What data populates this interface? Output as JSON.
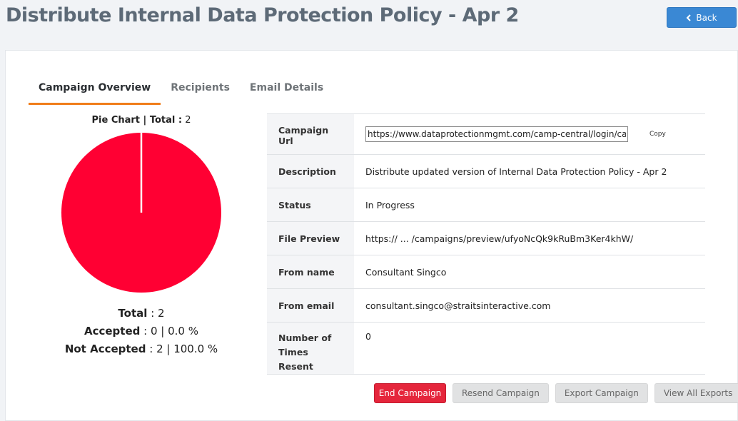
{
  "header": {
    "title": "Distribute Internal Data Protection Policy - Apr 2",
    "back_label": "Back"
  },
  "tabs": [
    {
      "label": "Campaign Overview",
      "active": true
    },
    {
      "label": "Recipients",
      "active": false
    },
    {
      "label": "Email Details",
      "active": false
    }
  ],
  "chart": {
    "title_label": "Pie Chart | Total :",
    "title_value": "2",
    "total_label": "Total",
    "total_value": ": 2",
    "accepted_label": "Accepted",
    "accepted_value": ": 0 | 0.0 %",
    "not_accepted_label": "Not Accepted",
    "not_accepted_value": ": 2 | 100.0 %"
  },
  "chart_data": {
    "type": "pie",
    "categories": [
      "Accepted",
      "Not Accepted"
    ],
    "values": [
      0,
      2
    ],
    "colors": [
      "#ffffff",
      "#ff0033"
    ]
  },
  "details": {
    "campaign_url_label": "Campaign Url",
    "campaign_url_value": "https://www.dataprotectionmgmt.com/camp-central/login/cam",
    "copy_label": "Copy",
    "description_label": "Description",
    "description_value": "Distribute updated version of Internal Data Protection Policy - Apr 2",
    "status_label": "Status",
    "status_value": "In Progress",
    "file_preview_label": "File Preview",
    "file_preview_value": "https:// ... /campaigns/preview/ufyoNcQk9kRuBm3Ker4khW/",
    "from_name_label": "From name",
    "from_name_value": "Consultant Singco",
    "from_email_label": "From email",
    "from_email_value": "consultant.singco@straitsinteractive.com",
    "resent_label": "Number of Times Resent",
    "resent_value": "0"
  },
  "actions": {
    "end_campaign": "End Campaign",
    "resend_campaign": "Resend Campaign",
    "export_campaign": "Export Campaign",
    "view_all_exports": "View All Exports"
  },
  "colors": {
    "accent": "#f07d1a",
    "primary": "#3a88d4",
    "danger": "#e5263c",
    "status_green": "#20b39b",
    "pie_red": "#ff0033"
  }
}
